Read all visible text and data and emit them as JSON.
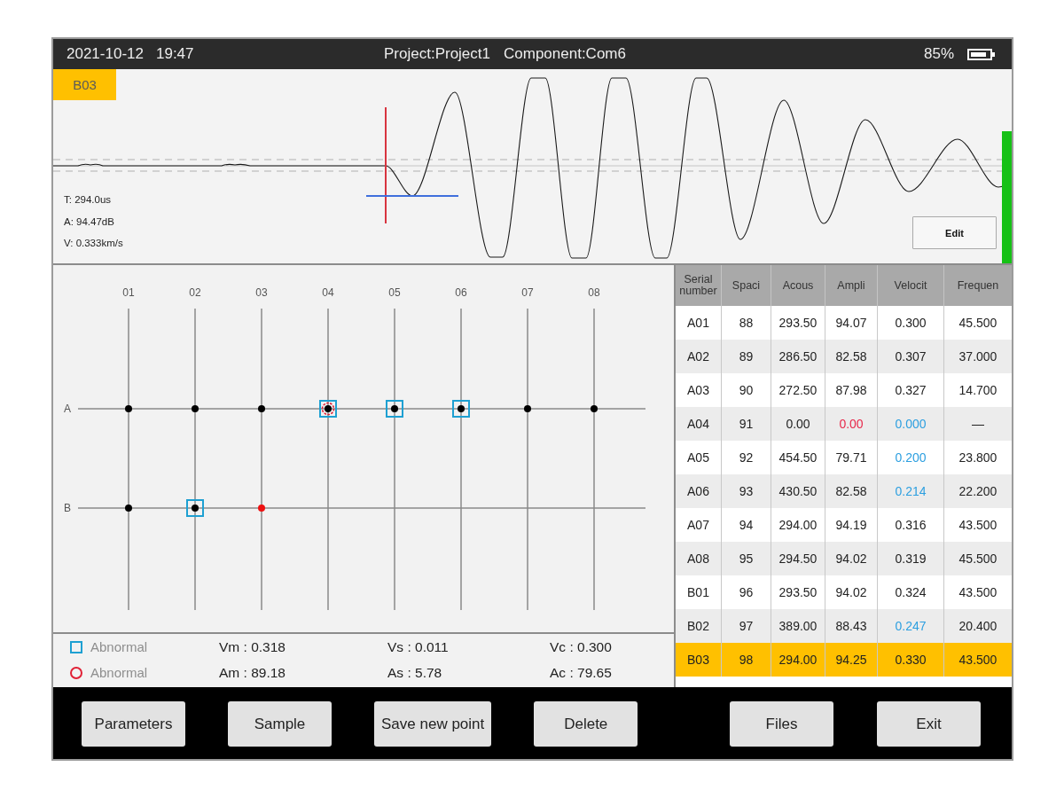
{
  "status_bar": {
    "date": "2021-10-12",
    "time": "19:47",
    "project": "Project:Project1",
    "component": "Component:Com6",
    "battery": "85%"
  },
  "waveform": {
    "point": "B03",
    "readouts": [
      "T: 294.0us",
      "A: 94.47dB",
      "V: 0.333km/s"
    ],
    "edit_button": "Edit"
  },
  "grid": {
    "columns": [
      "01",
      "02",
      "03",
      "04",
      "05",
      "06",
      "07",
      "08"
    ],
    "rows": [
      {
        "label": "A",
        "points": [
          {
            "selected": false,
            "abnormal_velocity": false,
            "abnormal_amplitude": false
          },
          {
            "selected": false,
            "abnormal_velocity": false,
            "abnormal_amplitude": false
          },
          {
            "selected": false,
            "abnormal_velocity": false,
            "abnormal_amplitude": false
          },
          {
            "selected": false,
            "abnormal_velocity": true,
            "abnormal_amplitude": true
          },
          {
            "selected": false,
            "abnormal_velocity": true,
            "abnormal_amplitude": false
          },
          {
            "selected": false,
            "abnormal_velocity": true,
            "abnormal_amplitude": false
          },
          {
            "selected": false,
            "abnormal_velocity": false,
            "abnormal_amplitude": false
          },
          {
            "selected": false,
            "abnormal_velocity": false,
            "abnormal_amplitude": false
          }
        ]
      },
      {
        "label": "B",
        "points": [
          {
            "selected": false,
            "abnormal_velocity": false,
            "abnormal_amplitude": false
          },
          {
            "selected": false,
            "abnormal_velocity": true,
            "abnormal_amplitude": false
          },
          {
            "selected": true,
            "abnormal_velocity": false,
            "abnormal_amplitude": false
          }
        ]
      }
    ]
  },
  "legend": [
    {
      "kind": "square",
      "color": "#1ea0d2",
      "label": "Abnormal"
    },
    {
      "kind": "circle",
      "color": "#e02035",
      "label": "Abnormal"
    }
  ],
  "stats": [
    "Vm : 0.318",
    "Vs : 0.011",
    "Vc : 0.300",
    "Am : 89.18",
    "As : 5.78",
    "Ac : 79.65"
  ],
  "table": {
    "columns": [
      "Serial number",
      "Spaci",
      "Acous",
      "Ampli",
      "Velocit",
      "Frequen"
    ],
    "rows": [
      {
        "selected": false,
        "cells": [
          {
            "text": "A01"
          },
          {
            "text": "88"
          },
          {
            "text": "293.50"
          },
          {
            "text": "94.07"
          },
          {
            "text": "0.300"
          },
          {
            "text": "45.500"
          }
        ]
      },
      {
        "selected": false,
        "cells": [
          {
            "text": "A02"
          },
          {
            "text": "89"
          },
          {
            "text": "286.50"
          },
          {
            "text": "82.58"
          },
          {
            "text": "0.307"
          },
          {
            "text": "37.000"
          }
        ]
      },
      {
        "selected": false,
        "cells": [
          {
            "text": "A03"
          },
          {
            "text": "90"
          },
          {
            "text": "272.50"
          },
          {
            "text": "87.98"
          },
          {
            "text": "0.327"
          },
          {
            "text": "14.700"
          }
        ]
      },
      {
        "selected": false,
        "cells": [
          {
            "text": "A04"
          },
          {
            "text": "91"
          },
          {
            "text": "0.00"
          },
          {
            "text": "0.00",
            "color": "#e8284a"
          },
          {
            "text": "0.000",
            "color": "#2c9fe0"
          },
          {
            "text": "—"
          }
        ]
      },
      {
        "selected": false,
        "cells": [
          {
            "text": "A05"
          },
          {
            "text": "92"
          },
          {
            "text": "454.50"
          },
          {
            "text": "79.71"
          },
          {
            "text": "0.200",
            "color": "#2c9fe0"
          },
          {
            "text": "23.800"
          }
        ]
      },
      {
        "selected": false,
        "cells": [
          {
            "text": "A06"
          },
          {
            "text": "93"
          },
          {
            "text": "430.50"
          },
          {
            "text": "82.58"
          },
          {
            "text": "0.214",
            "color": "#2c9fe0"
          },
          {
            "text": "22.200"
          }
        ]
      },
      {
        "selected": false,
        "cells": [
          {
            "text": "A07"
          },
          {
            "text": "94"
          },
          {
            "text": "294.00"
          },
          {
            "text": "94.19"
          },
          {
            "text": "0.316"
          },
          {
            "text": "43.500"
          }
        ]
      },
      {
        "selected": false,
        "cells": [
          {
            "text": "A08"
          },
          {
            "text": "95"
          },
          {
            "text": "294.50"
          },
          {
            "text": "94.02"
          },
          {
            "text": "0.319"
          },
          {
            "text": "45.500"
          }
        ]
      },
      {
        "selected": false,
        "cells": [
          {
            "text": "B01"
          },
          {
            "text": "96"
          },
          {
            "text": "293.50"
          },
          {
            "text": "94.02"
          },
          {
            "text": "0.324"
          },
          {
            "text": "43.500"
          }
        ]
      },
      {
        "selected": false,
        "cells": [
          {
            "text": "B02"
          },
          {
            "text": "97"
          },
          {
            "text": "389.00"
          },
          {
            "text": "88.43"
          },
          {
            "text": "0.247",
            "color": "#2c9fe0"
          },
          {
            "text": "20.400"
          }
        ]
      },
      {
        "selected": true,
        "cells": [
          {
            "text": "B03"
          },
          {
            "text": "98"
          },
          {
            "text": "294.00"
          },
          {
            "text": "94.25"
          },
          {
            "text": "0.330"
          },
          {
            "text": "43.500"
          }
        ]
      }
    ]
  },
  "buttons": {
    "left": [
      "Parameters",
      "Sample",
      "Save new point",
      "Delete"
    ],
    "right": [
      "Files",
      "Exit"
    ]
  }
}
